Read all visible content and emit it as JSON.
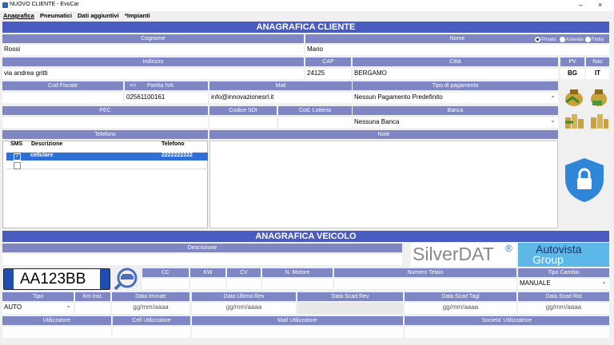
{
  "window": {
    "title": "NUOVO CLIENTE - EvoCar",
    "minimize": "–",
    "close": "×"
  },
  "menu": [
    "Anagrafica",
    "Pneumatici",
    "Dati aggiuntivi",
    "*Impianti"
  ],
  "cliente": {
    "header": "ANAGRAFICA CLIENTE",
    "labels": {
      "cognome": "Cognome",
      "nome": "Nome",
      "indirizzo": "Indirizzo",
      "cap": "CAP",
      "citta": "Città",
      "pv": "PV",
      "naz": "Naz",
      "cf": "Cod Fiscale",
      "piva_arrow": "<<",
      "piva": "Partita IVA",
      "mail": "Mail",
      "tipo_pagamento": "Tipo di pagamento",
      "pec": "PEC",
      "sdi": "Codice SDI",
      "lotteria": "Cod. Lotteria",
      "banca": "Banca",
      "telefono": "Telefono",
      "note": "Note"
    },
    "radio": {
      "privato": "Privato",
      "azienda": "Azienda",
      "flotta": "Flotta"
    },
    "values": {
      "cognome": "Rossi",
      "nome": "Mario",
      "indirizzo": "via andrea gritti",
      "cap": "24125",
      "citta": "BERGAMO",
      "pv": "BG",
      "naz": "IT",
      "cf": "",
      "piva": "02561100161",
      "mail": "info@innovazionesrl.it",
      "tipo_pagamento": "Nessun Pagamento Predefinito",
      "pec": "",
      "sdi": "",
      "lotteria": "",
      "banca": "Nessuna Banca",
      "note": ""
    },
    "phone_table": {
      "headers": [
        "SMS",
        "Descrizione",
        "Telefono"
      ],
      "rows": [
        {
          "sms": "✓",
          "descrizione": "cellulare",
          "telefono": "2222222222"
        },
        {
          "sms": "",
          "descrizione": "",
          "telefono": ""
        }
      ]
    }
  },
  "veicolo": {
    "header": "ANAGRAFICA VEICOLO",
    "labels": {
      "descrizione": "Descrizione",
      "cc": "CC",
      "kw": "KW",
      "cv": "CV",
      "motore": "N. Motore",
      "telaio": "Numero Telaio",
      "cambio": "Tipo Cambio",
      "tipo": "Tipo",
      "km": "Km Iniz.",
      "immatr": "Data Immatr",
      "ultima_rev": "Data Ultima Rev",
      "scad_rev": "Data Scad Rev",
      "scad_tagl": "Data Scad Tagl",
      "scad_rot": "Data Scad Rot",
      "utilizzatore": "Utilizzatore",
      "cell": "Cell Utilizzatore",
      "mail_util": "Mail Utilizzatore",
      "societa": "Societa' Utilizzatrice"
    },
    "plate": "AA123BB",
    "values": {
      "cambio": "MANUALE",
      "tipo": "AUTO",
      "date_placeholder": "gg/mm/aaaa"
    },
    "logos": {
      "silverdat": "SilverDAT",
      "reg": "®",
      "autovista1": "Autovista",
      "autovista2": "Group"
    }
  },
  "colors": {
    "header": "#4a5cc0",
    "label": "#7e86c4",
    "selected_row": "#2f6fd6",
    "shield": "#2f86d6"
  }
}
